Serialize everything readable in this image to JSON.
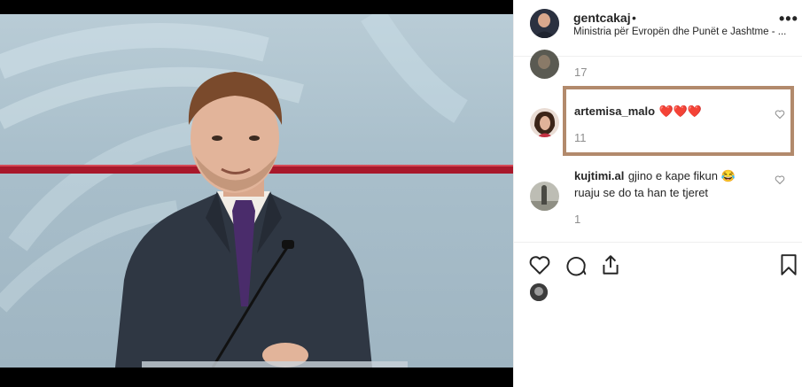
{
  "post": {
    "username": "gentcakaj",
    "separator": "•",
    "location": "Ministria për Evropën dhe Punët e Jashtme - ...",
    "more_label": "•••"
  },
  "comments": [
    {
      "username": "",
      "text": "",
      "meta": "17"
    },
    {
      "username": "artemisa_malo",
      "text": "❤️❤️❤️",
      "meta": "11"
    },
    {
      "username": "kujtimi.al",
      "text": "gjino e kape fikun 😂 ruaju se do ta han te tjeret",
      "meta": "1"
    }
  ],
  "actions": [
    "heart-icon",
    "comment-icon",
    "share-icon",
    "bookmark-icon"
  ],
  "colors": {
    "highlight": "#b28a6c",
    "heart": "#ed4956",
    "muted": "#8e8e8e"
  }
}
